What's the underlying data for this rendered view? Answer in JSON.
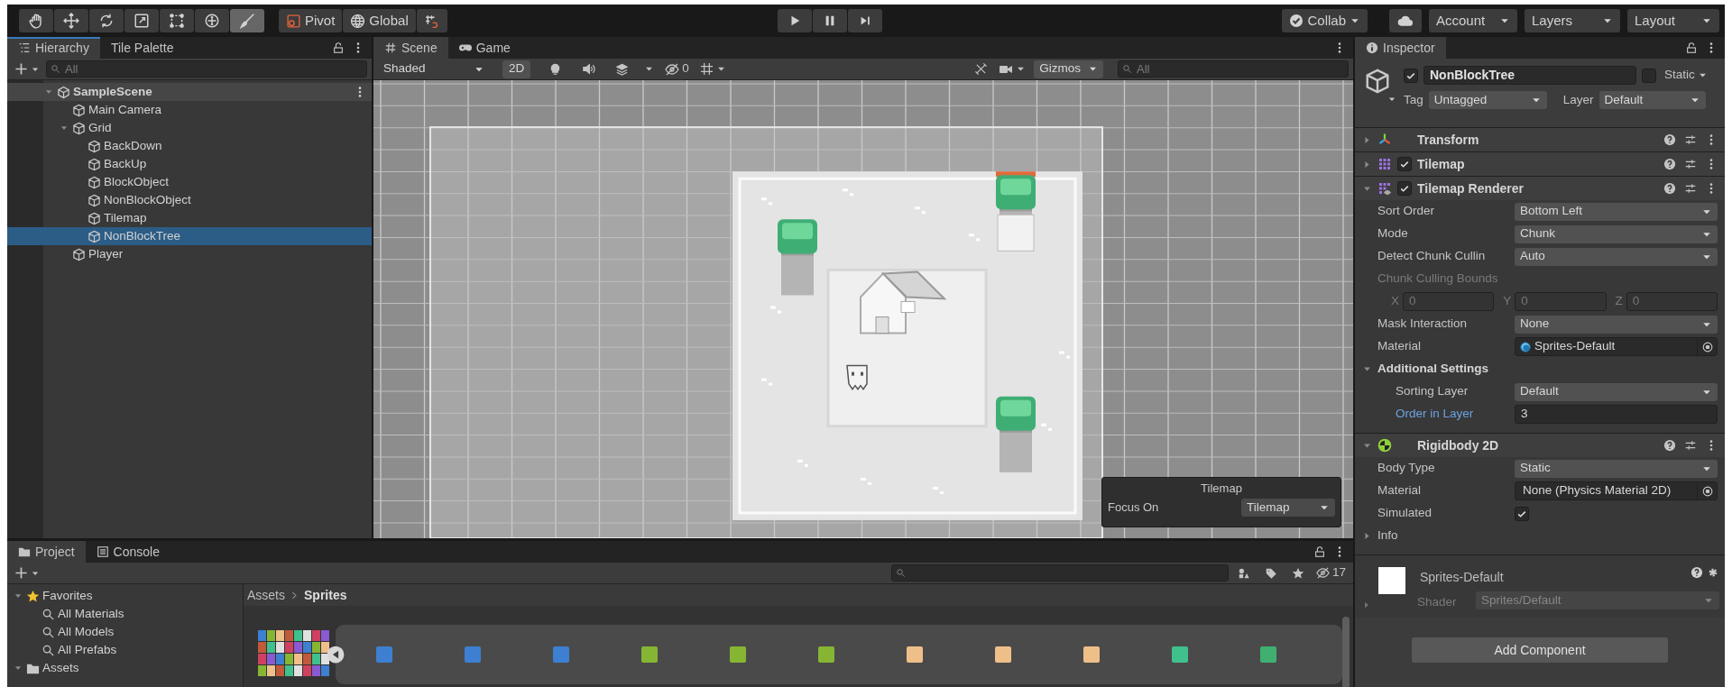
{
  "toolbar": {
    "tools": [
      {
        "selected": false
      },
      {
        "selected": false
      },
      {
        "selected": false
      },
      {
        "selected": false
      },
      {
        "selected": false
      },
      {
        "selected": false
      },
      {
        "selected": true
      }
    ],
    "pivot": "Pivot",
    "global": "Global",
    "collab": "Collab",
    "account": "Account",
    "layers": "Layers",
    "layout": "Layout"
  },
  "hierarchy": {
    "tabs": [
      {
        "label": "Hierarchy",
        "selected": true
      },
      {
        "label": "Tile Palette",
        "selected": false
      }
    ],
    "placeholder": "All",
    "tree": [
      {
        "label": "SampleScene",
        "kind": "scene",
        "expanded": true,
        "children": [
          {
            "label": "Main Camera",
            "kind": "object",
            "selected": false
          },
          {
            "label": "Grid",
            "kind": "object",
            "selected": false,
            "expanded": true,
            "children": [
              {
                "label": "BackDown",
                "kind": "object",
                "selected": false
              },
              {
                "label": "BackUp",
                "kind": "object",
                "selected": false
              },
              {
                "label": "BlockObject",
                "kind": "object",
                "selected": false
              },
              {
                "label": "NonBlockObject",
                "kind": "object",
                "selected": false
              },
              {
                "label": "Tilemap",
                "kind": "object",
                "selected": false
              },
              {
                "label": "NonBlockTree",
                "kind": "object",
                "selected": true
              }
            ]
          },
          {
            "label": "Player",
            "kind": "object",
            "selected": false
          }
        ]
      }
    ]
  },
  "scene": {
    "tabs": [
      {
        "label": "Scene",
        "selected": true
      },
      {
        "label": "Game",
        "selected": false
      }
    ],
    "toggles": [
      {
        "on": false
      },
      {
        "on": false
      },
      {
        "on": false
      },
      {
        "on": false
      }
    ],
    "shading": "Shaded",
    "mode_2d": "2D",
    "hidden_count": "0",
    "gizmos": "Gizmos",
    "placeholder": "All",
    "overlay": {
      "title": "Tilemap",
      "label": "Focus On",
      "value": "Tilemap"
    }
  },
  "inspector": {
    "tab": "Inspector",
    "object": {
      "active": true,
      "name": "NonBlockTree",
      "static": false,
      "static_label": "Static",
      "tag_label": "Tag",
      "tag": "Untagged",
      "layer_label": "Layer",
      "layer": "Default"
    },
    "components": [
      {
        "name": "Transform",
        "kind": "transform",
        "expanded": false
      },
      {
        "name": "Tilemap",
        "kind": "tilemap",
        "expanded": false,
        "enabled": true
      },
      {
        "name": "Tilemap Renderer",
        "kind": "tilemap_renderer",
        "expanded": true,
        "enabled": true,
        "properties": [
          {
            "kind": "dropdown",
            "label": "Sort Order",
            "value": "Bottom Left"
          },
          {
            "kind": "dropdown",
            "label": "Mode",
            "value": "Chunk"
          },
          {
            "kind": "dropdown",
            "label": "Detect Chunk Cullin",
            "value": "Auto"
          },
          {
            "kind": "caption",
            "label": "Chunk Culling Bounds",
            "disabled": true
          },
          {
            "kind": "vector",
            "disabled": true,
            "fields": [
              {
                "axis": "X",
                "value": "0"
              },
              {
                "axis": "Y",
                "value": "0"
              },
              {
                "axis": "Z",
                "value": "0"
              }
            ]
          },
          {
            "kind": "dropdown",
            "label": "Mask Interaction",
            "value": "None"
          },
          {
            "kind": "object",
            "label": "Material",
            "value": "Sprites-Default",
            "asset": true
          },
          {
            "kind": "foldout",
            "label": "Additional Settings",
            "expanded": true,
            "children": [
              {
                "kind": "dropdown",
                "label": "Sorting Layer",
                "value": "Default"
              },
              {
                "kind": "number",
                "label": "Order in Layer",
                "value": "3",
                "focused": true
              }
            ]
          }
        ]
      },
      {
        "name": "Rigidbody 2D",
        "kind": "rigidbody",
        "expanded": true,
        "properties": [
          {
            "kind": "dropdown",
            "label": "Body Type",
            "value": "Static"
          },
          {
            "kind": "object",
            "label": "Material",
            "value": "None (Physics Material 2D)",
            "asset": false
          },
          {
            "kind": "checkbox",
            "label": "Simulated",
            "checked": true
          },
          {
            "kind": "foldout",
            "label": "Info",
            "expanded": false
          }
        ]
      }
    ],
    "material": {
      "name": "Sprites-Default",
      "shader_label": "Shader",
      "shader": "Sprites/Default"
    },
    "add_button": "Add Component"
  },
  "project": {
    "tabs": [
      {
        "label": "Project",
        "selected": true
      },
      {
        "label": "Console",
        "selected": false
      }
    ],
    "hidden_count": "17",
    "tree": [
      {
        "label": "Favorites",
        "kind": "favorites",
        "expanded": true,
        "children": [
          {
            "label": "All Materials",
            "kind": "search"
          },
          {
            "label": "All Models",
            "kind": "search"
          },
          {
            "label": "All Prefabs",
            "kind": "search"
          }
        ]
      },
      {
        "label": "Assets",
        "kind": "folder",
        "expanded": true
      }
    ],
    "breadcrumb": [
      "Assets",
      "Sprites"
    ],
    "sprites": [
      {
        "color": "#3d7fd0"
      },
      {
        "color": "#3d7fd0"
      },
      {
        "color": "#3d7fd0"
      },
      {
        "color": "#86b534"
      },
      {
        "color": "#86b534"
      },
      {
        "color": "#86b534"
      },
      {
        "color": "#efbf8a"
      },
      {
        "color": "#efbf8a"
      },
      {
        "color": "#efbf8a"
      },
      {
        "color": "#40c08c"
      },
      {
        "color": "#40b070"
      }
    ]
  }
}
